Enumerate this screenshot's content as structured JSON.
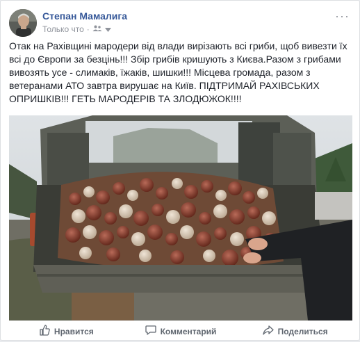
{
  "post": {
    "author": "Степан Мамалига",
    "timestamp": "Только что",
    "audience_icon": "friends-icon",
    "menu_icon": "more-dots-icon",
    "text": "Отак на Рахівщині мародери від влади вирізають всі гриби, щоб вивезти їх всі до Європи за безцінь!!! Збір грибів кришують з Києва.Разом з грибами вивозять усе - слимаків, їжаків, шишки!!! Місцева громада, разом з ветеранами АТО завтра вирушає на Київ. ПІДТРИМАЙ РАХІВСЬКИХ ОПРИШКІВ!!! ГЕТЬ МАРОДЕРІВ ТА ЗЛОДЮЖОК!!!!"
  },
  "actions": [
    {
      "label": "Нравится",
      "icon": "like-icon"
    },
    {
      "label": "Комментарий",
      "icon": "comment-icon"
    },
    {
      "label": "Поделиться",
      "icon": "share-icon"
    }
  ],
  "colors": {
    "author_link": "#365899",
    "meta_text": "#90949c",
    "action_text": "#606770"
  }
}
